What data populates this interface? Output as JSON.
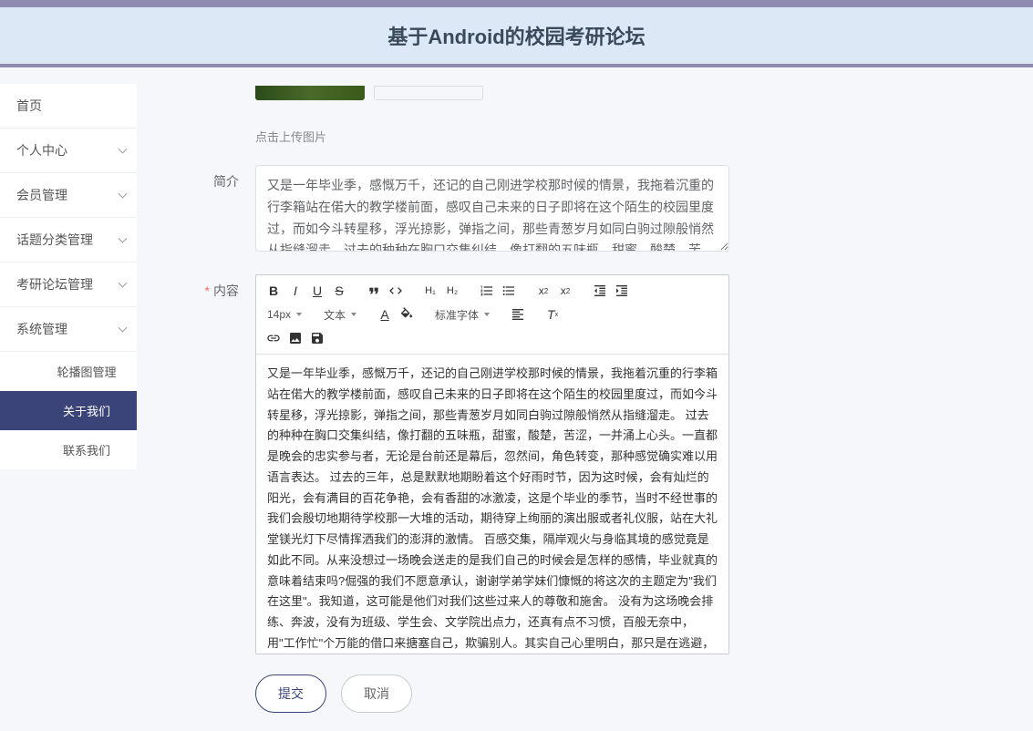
{
  "header": {
    "title": "基于Android的校园考研论坛"
  },
  "sidebar": {
    "items": [
      {
        "label": "首页",
        "expandable": false
      },
      {
        "label": "个人中心",
        "expandable": true
      },
      {
        "label": "会员管理",
        "expandable": true
      },
      {
        "label": "话题分类管理",
        "expandable": true
      },
      {
        "label": "考研论坛管理",
        "expandable": true
      },
      {
        "label": "系统管理",
        "expandable": true
      }
    ],
    "sub_items": [
      {
        "label": "轮播图管理",
        "active": false
      },
      {
        "label": "关于我们",
        "active": true
      },
      {
        "label": "联系我们",
        "active": false
      }
    ]
  },
  "form": {
    "upload_hint": "点击上传图片",
    "intro_label": "简介",
    "intro_value": "又是一年毕业季，感慨万千，还记的自己刚进学校那时候的情景，我拖着沉重的行李箱站在偌大的教学楼前面，感叹自己未来的日子即将在这个陌生的校园里度过，而如今斗转星移，浮光掠影，弹指之间，那些青葱岁月如同白驹过隙般悄然从指缝溜走。过去的种种在胸口交集纠结，像打翻的五味瓶，甜蜜，酸楚，苦涩，一并涌上心头。",
    "content_label": "内容",
    "editor_font_size": "14px",
    "editor_text_type": "文本",
    "editor_font_family": "标准字体",
    "content_value": "又是一年毕业季，感慨万千，还记的自己刚进学校那时候的情景，我拖着沉重的行李箱站在偌大的教学楼前面，感叹自己未来的日子即将在这个陌生的校园里度过，而如今斗转星移，浮光掠影，弹指之间，那些青葱岁月如同白驹过隙般悄然从指缝溜走。\n过去的种种在胸口交集纠结，像打翻的五味瓶，甜蜜，酸楚，苦涩，一并涌上心头。一直都是晚会的忠实参与者，无论是台前还是幕后，忽然间，角色转变，那种感觉确实难以用语言表达。\n过去的三年，总是默默地期盼着这个好雨时节，因为这时候，会有灿烂的阳光，会有满目的百花争艳，会有香甜的冰激凌，这是个毕业的季节，当时不经世事的我们会殷切地期待学校那一大堆的活动，期待穿上绚丽的演出服或者礼仪服，站在大礼堂镁光灯下尽情挥洒我们的澎湃的激情。\n百感交集，隔岸观火与身临其境的感觉竟是如此不同。从来没想过一场晚会送走的是我们自己的时候会是怎样的感情，毕业就真的意味着结束吗?倔强的我们不愿意承认，谢谢学弟学妹们慷慨的将这次的主题定为\"我们在这里\"。我知道，这可能是他们对我们这些过来人的尊敬和施舍。\n没有为这场晚会排练、奔波，没有为班级、学生会、文学院出点力，还真有点不习惯，百般无奈中，用\"工作忙\"个万能的借口来搪塞自己，欺骗别人。其实自己心里明白，那只是在逃避，只是不愿面对繁华落幕后的萧条和落寞。大四了，大家各奔东西，想凑齐班上的人真的是难上加难，敏燕从越南回来，刚落地就匆匆回了学校，那么恋家的人也启程回来了，睿睿学姐也是从家赶来跟我们团圆。大家一如既往的寒暄、打趣、调侃对方，似乎一切又回到了当初的单纯美好。\n看着舞台上洒泼可爱的学弟学妹们，如同一群机灵的小精灵，清澈的眼神，稚嫩的肢体，轻快地步伐，用他们那热情洋溢的舞姿渲染着在场的每一个人。我知道，我不应该羡慕嫉妒他们，不应该顾自怜惜逝去的青春，不应该感叹夕阳无限好，曾经，我们也拥有过，曾经，我们也年轻过，曾经，我们也灿烂过。我深深地告诉自己，人生的每个阶段都是美的，年轻有年轻的活力，成熟也有成熟的魅力。多一份稳重、淡然、优雅，也是漫漫时光掠影遗留下的 珍贵赏赐。|"
  },
  "actions": {
    "submit": "提交",
    "cancel": "取消"
  }
}
